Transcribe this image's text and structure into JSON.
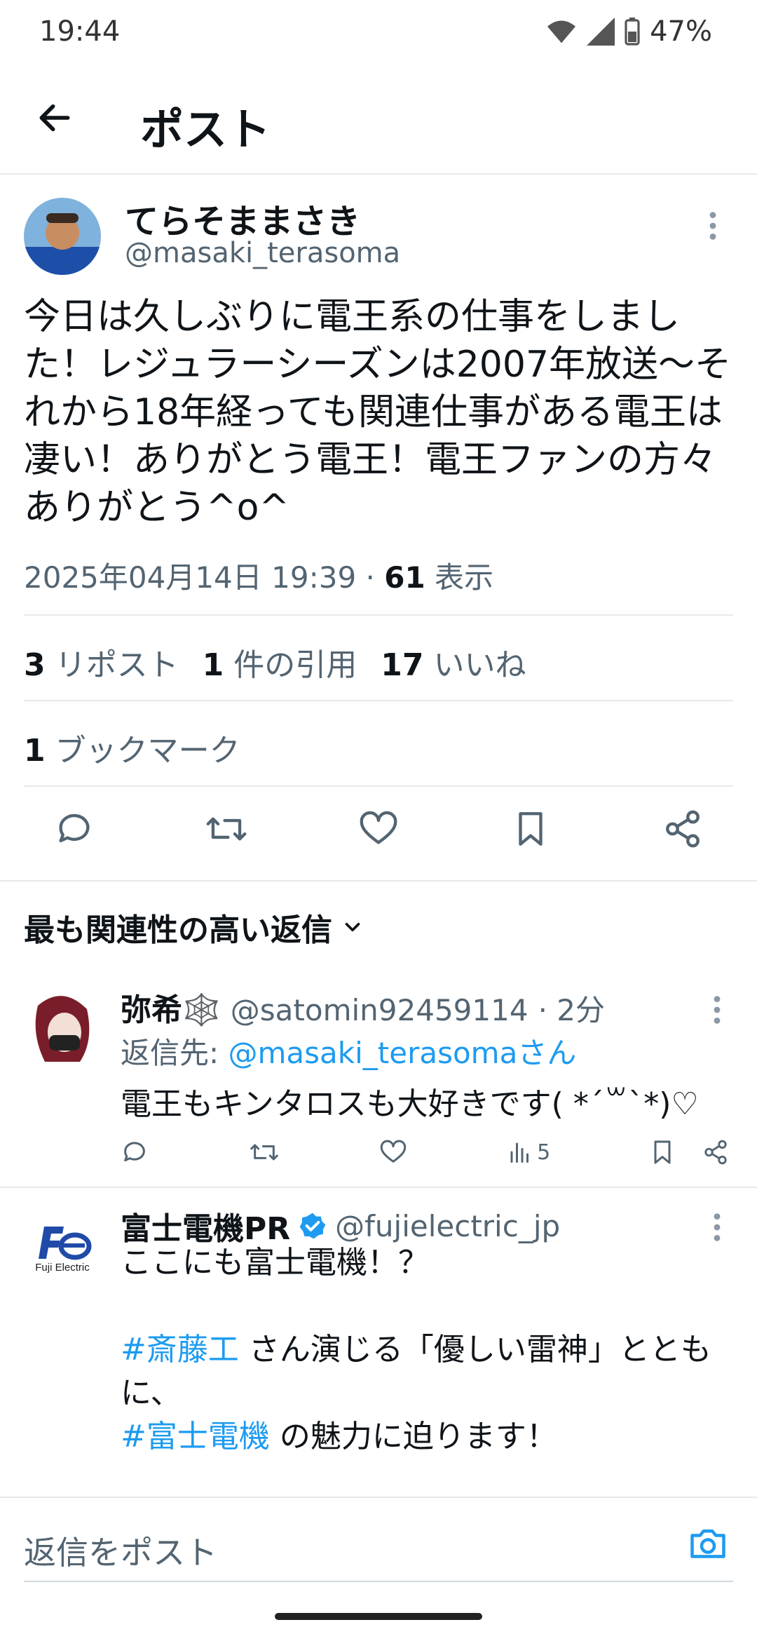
{
  "status_bar": {
    "time": "19:44",
    "battery": "47%"
  },
  "header": {
    "title": "ポスト"
  },
  "post": {
    "author_name": "てらそままさき",
    "author_handle": "@masaki_terasoma",
    "body": "今日は久しぶりに電王系の仕事をしました！レジュラーシーズンは2007年放送〜それから18年経っても関連仕事がある電王は凄い！ありがとう電王！電王ファンの方々ありがとう^o^",
    "timestamp": "2025年04月14日 19:39",
    "views_count": "61",
    "views_label": "表示",
    "reposts_count": "3",
    "reposts_label": "リポスト",
    "quotes_count": "1",
    "quotes_label": "件の引用",
    "likes_count": "17",
    "likes_label": "いいね",
    "bookmarks_count": "1",
    "bookmarks_label": "ブックマーク"
  },
  "sort": {
    "label": "最も関連性の高い返信"
  },
  "replies": [
    {
      "name": "弥希🕸️",
      "handle": "@satomin92459114",
      "time": "· 2分",
      "reply_to_prefix": "返信先: ",
      "reply_to": "@masaki_terasomaさん",
      "text": "電王もキンタロスも大好きです( *´꒳`*)♡",
      "views": "5"
    },
    {
      "name": "富士電機PR",
      "handle": "@fujielectric_jp",
      "line1": "ここにも富士電機！？",
      "tag1": "#斎藤工",
      "line2_rest": " さん演じる「優しい雷神」とともに、",
      "tag2": "#富士電機",
      "line3_rest": " の魅力に迫ります！",
      "logo_text": "Fuji Electric"
    }
  ],
  "composer": {
    "placeholder": "返信をポスト"
  },
  "colors": {
    "accent": "#1d9bf0",
    "muted": "#536471"
  }
}
